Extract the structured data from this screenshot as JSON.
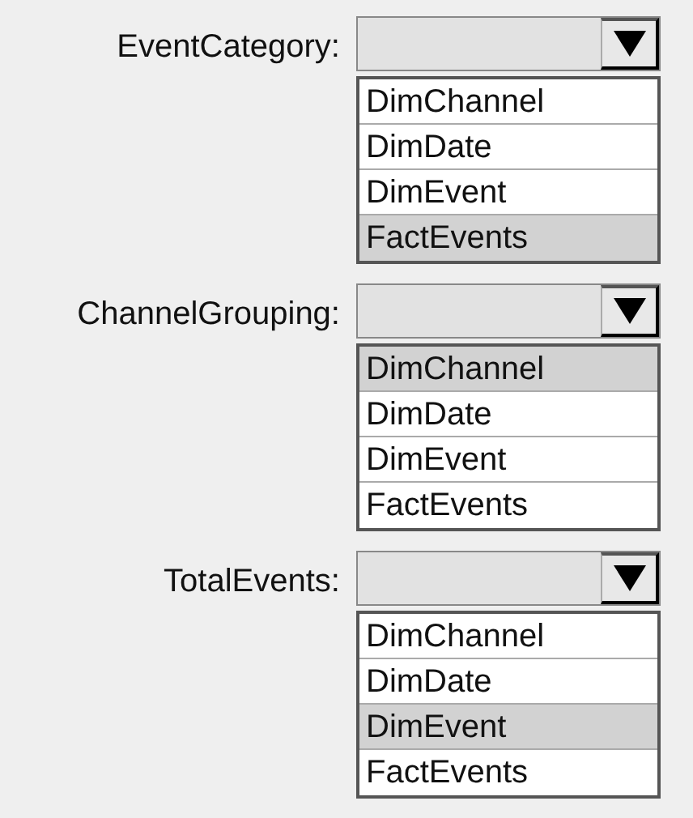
{
  "dropdowns": [
    {
      "label": "EventCategory:",
      "options": [
        {
          "text": "DimChannel",
          "selected": false
        },
        {
          "text": "DimDate",
          "selected": false
        },
        {
          "text": "DimEvent",
          "selected": false
        },
        {
          "text": "FactEvents",
          "selected": true
        }
      ]
    },
    {
      "label": "ChannelGrouping:",
      "options": [
        {
          "text": "DimChannel",
          "selected": true
        },
        {
          "text": "DimDate",
          "selected": false
        },
        {
          "text": "DimEvent",
          "selected": false
        },
        {
          "text": "FactEvents",
          "selected": false
        }
      ]
    },
    {
      "label": "TotalEvents:",
      "options": [
        {
          "text": "DimChannel",
          "selected": false
        },
        {
          "text": "DimDate",
          "selected": false
        },
        {
          "text": "DimEvent",
          "selected": true
        },
        {
          "text": "FactEvents",
          "selected": false
        }
      ]
    }
  ]
}
